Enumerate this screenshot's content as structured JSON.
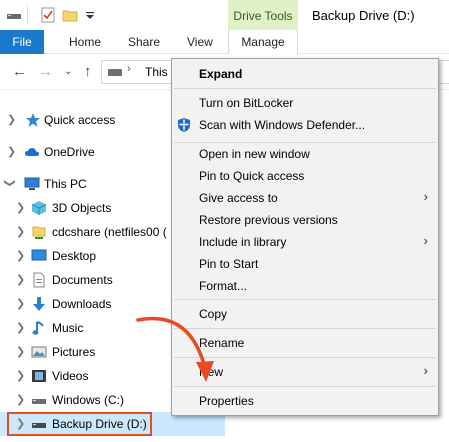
{
  "titlebar": {
    "drive_tools": "Drive Tools",
    "window_title": "Backup Drive (D:)"
  },
  "ribbon": {
    "tabs": [
      {
        "label": "File"
      },
      {
        "label": "Home"
      },
      {
        "label": "Share"
      },
      {
        "label": "View"
      },
      {
        "label": "Manage"
      }
    ]
  },
  "address": {
    "path_text": "This"
  },
  "tree": {
    "items": [
      {
        "label": "Quick access",
        "icon": "star-icon"
      },
      {
        "label": "OneDrive",
        "icon": "cloud-icon"
      },
      {
        "label": "This PC",
        "icon": "computer-icon"
      },
      {
        "label": "3D Objects",
        "icon": "cube-icon"
      },
      {
        "label": "cdcshare (netfiles00 (",
        "icon": "network-drive-icon"
      },
      {
        "label": "Desktop",
        "icon": "desktop-icon"
      },
      {
        "label": "Documents",
        "icon": "document-icon"
      },
      {
        "label": "Downloads",
        "icon": "download-icon"
      },
      {
        "label": "Music",
        "icon": "music-icon"
      },
      {
        "label": "Pictures",
        "icon": "picture-icon"
      },
      {
        "label": "Videos",
        "icon": "film-icon"
      },
      {
        "label": "Windows (C:)",
        "icon": "drive-icon"
      },
      {
        "label": "Backup Drive (D:)",
        "icon": "drive-icon"
      }
    ]
  },
  "context_menu": {
    "items": [
      {
        "label": "Expand"
      },
      {
        "label": "Turn on BitLocker"
      },
      {
        "label": "Scan with Windows Defender..."
      },
      {
        "label": "Open in new window"
      },
      {
        "label": "Pin to Quick access"
      },
      {
        "label": "Give access to"
      },
      {
        "label": "Restore previous versions"
      },
      {
        "label": "Include in library"
      },
      {
        "label": "Pin to Start"
      },
      {
        "label": "Format..."
      },
      {
        "label": "Copy"
      },
      {
        "label": "Rename"
      },
      {
        "label": "New"
      },
      {
        "label": "Properties"
      }
    ]
  },
  "colors": {
    "file_tab": "#1979ca",
    "drive_tools_bg": "#dff1c6",
    "selection": "#cce8ff",
    "annotation": "#e84c22"
  }
}
